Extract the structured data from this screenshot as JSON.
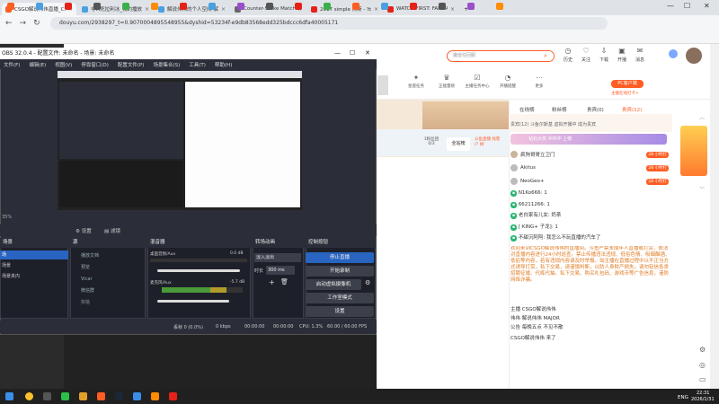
{
  "browser": {
    "tabs": [
      {
        "title": "CSGO解说伟伟直播_CSGO解",
        "active": true,
        "color": "#ff5d23"
      },
      {
        "title": "非M死拉利冰_我的播放器_",
        "active": false,
        "color": "#4aa0e0"
      },
      {
        "title": "解说伟伟的个人空间-解说伟伟",
        "active": false,
        "color": "#4aa0e0"
      },
      {
        "title": "Counter-Strike Matches & R",
        "active": false,
        "color": "#666666"
      },
      {
        "title": "2017 simple 杰斯 - YouTube",
        "active": false,
        "color": "#e62117"
      },
      {
        "title": "WATCH FIRST: FAKE AWP by",
        "active": false,
        "color": "#e62117"
      }
    ],
    "url": "douyu.com/2938297_t=0.9070004895548955&dyshid=53234f-e9db83568edd325bdccc6dfa40005171"
  },
  "obs": {
    "title": "OBS 32.0.4 - 配置文件: 未命名 - 场景: 未命名",
    "menu": [
      "文件(F)",
      "编辑(E)",
      "视图(V)",
      "停靠窗口(D)",
      "配置文件(P)",
      "场景集合(S)",
      "工具(T)",
      "帮助(H)"
    ],
    "zoom": "35%",
    "source_btns": [
      "设置",
      "滤镜"
    ],
    "panels": {
      "scenes": "场景",
      "sources": "源",
      "mixer": "混音器",
      "transitions": "转场动画",
      "controls": "控制按钮"
    },
    "scene_items": [
      "场",
      "场景",
      "预览",
      "场景夹内"
    ],
    "sources": [
      "播放文档",
      "预览",
      "Vicar",
      "微信群",
      "抖信"
    ],
    "mixer": [
      {
        "name": "桌面音频/Aux",
        "db": "0.0 dB"
      },
      {
        "name": "麦克风/Aux",
        "db": "-5.7 dB"
      }
    ],
    "transition": {
      "type": "淡入淡出",
      "duration_label": "时长",
      "duration": "300 ms"
    },
    "controls": [
      "停止直播",
      "开始录制",
      "启动虚拟摄像机",
      "工作室模式",
      "设置"
    ],
    "status": {
      "frames": "丢帧 0 (0.0%)",
      "kbps": "0 kbps",
      "rec": "00:00:00",
      "live": "00:00:00",
      "cpu": "CPU: 1.3%",
      "fps": "60.00 / 60.00 FPS"
    }
  },
  "douyu": {
    "search_placeholder": "魔兽任回服",
    "header_icons": [
      "历史",
      "关注",
      "下载",
      "开播",
      "消息"
    ],
    "sub_icons": [
      "星座任务",
      "正能量榜",
      "主播任务中心",
      "开播提醒",
      "更多"
    ],
    "pc_badge": "PC客户端",
    "pc_sub": "主播在线打卡+",
    "stats": [
      "1粉丝团",
      "0/3",
      "全站榜",
      "斗鱼直播 找客户 榜"
    ],
    "chat_tabs": [
      "在线榜",
      "粉丝榜",
      "贵宾(0)",
      "贵宾(12)"
    ],
    "rank_text": "贵宾(12) 斗鱼尔斯基 虚拟开播中 成为贵宾",
    "banner": "钻石大奖 冲冲冲 上榜",
    "rank_rows": [
      {
        "name": "疯狗哥哥立卫门",
        "badge": "28 小时打"
      },
      {
        "name": "Akitus",
        "badge": "28 小时打"
      },
      {
        "name": "NeoGeo+",
        "badge": "28 小时打"
      }
    ],
    "chat": [
      "N1Ko666: 1",
      "66211266: 1",
      "老白家有儿女: 奶茶",
      "[ KING+ 子龙]: 1",
      "不甜沉阿阿: 我怎么不玩直播的汽车了",
      "欢迎来到CSGO解说伟伟的直播间。斗鱼严禁未成年人直播或打赏，依法对直播内容进行24小时巡查。禁止传播违法违规、低俗色情、吸烟酗酒、低俗等内容，若有违规内容请及时举报。如主播在直播过程中以不正当方式诱导打赏，私下交易，请谨慎判断，以防人身财产损失。请勿轻信各类招聘征婚、代练代抽、私下交易、购买礼包码、游戏币等广告信息，谨防网络诈骗。",
      "主播 CSGO解说伟伟",
      "伟伟 解说伟伟 MAJOR",
      "公告 每晚五点 不见不散",
      "CSGO解说伟伟 来了"
    ]
  },
  "taskbar": {
    "lang": "ENG",
    "time": "22:31",
    "date": "2026/1/31"
  }
}
